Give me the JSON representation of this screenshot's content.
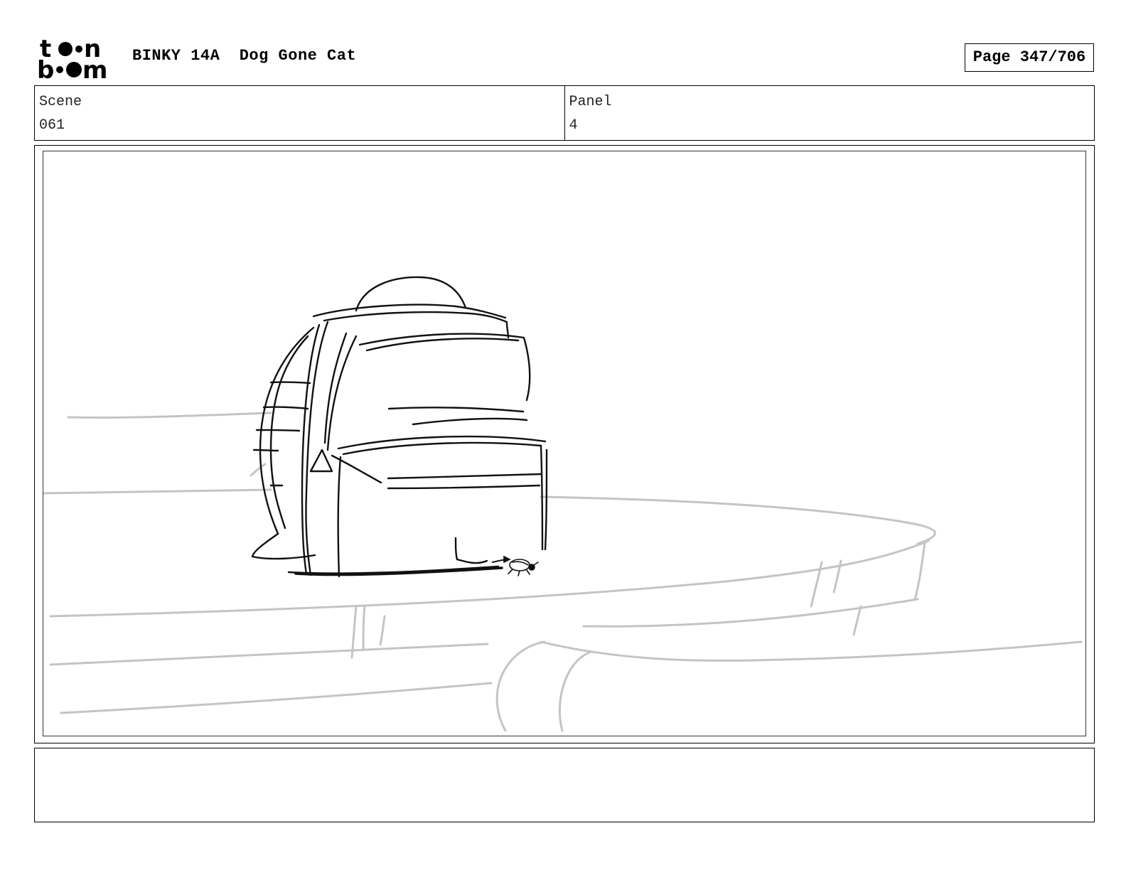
{
  "header": {
    "logo_top": "t",
    "logo_top_end": "n",
    "logo_bottom_start": "b",
    "logo_bottom_end": "m",
    "show_title": "BINKY 14A",
    "episode_title": "Dog Gone Cat",
    "page_label": "Page 347/706"
  },
  "info": {
    "scene_label": "Scene",
    "scene_value": "061",
    "panel_label": "Panel",
    "panel_value": "4"
  },
  "drawing": {
    "icons": [
      "backpack-sketch",
      "bug-sketch",
      "table-sketch"
    ],
    "ink_color": "#111111",
    "rough_color": "#c4c4c4"
  },
  "notes": {
    "text": ""
  }
}
